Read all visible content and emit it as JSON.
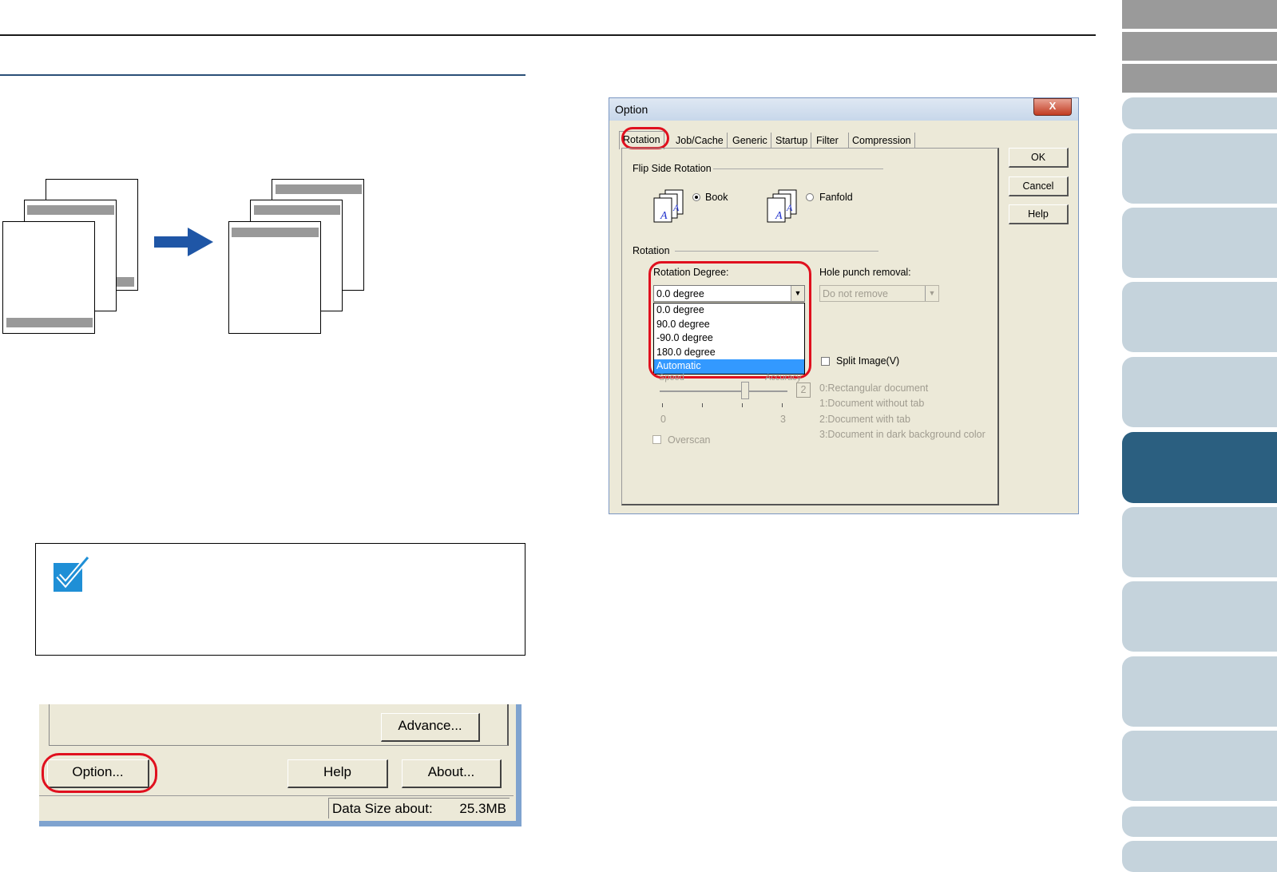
{
  "illustration": {
    "arrow": "right-arrow-icon"
  },
  "note": {
    "icon": "checkmark-icon"
  },
  "main_window": {
    "advance_label": "Advance...",
    "advance_access_key": "v",
    "option_label": "Option...",
    "option_access_key": "p",
    "help_label": "Help",
    "about_label": "About...",
    "data_size_label": "Data Size about:",
    "data_size_value": "25.3MB"
  },
  "dialog": {
    "title": "Option",
    "close_glyph": "X",
    "tabs": [
      "Rotation",
      "Job/Cache",
      "Generic",
      "Startup",
      "Filter",
      "Compression"
    ],
    "active_tab": "Rotation",
    "buttons": {
      "ok": "OK",
      "cancel": "Cancel",
      "help": "Help"
    },
    "flip_side": {
      "group_label": "Flip Side Rotation",
      "book_label": "Book",
      "fanfold_label": "Fanfold",
      "selected": "Book"
    },
    "rotation": {
      "group_label": "Rotation",
      "degree_label": "Rotation Degree:",
      "degree_value": "0.0 degree",
      "degree_options": [
        "0.0 degree",
        "90.0 degree",
        "-90.0 degree",
        "180.0 degree",
        "Automatic"
      ],
      "highlighted_option": "Automatic",
      "hole_punch_label": "Hole punch removal:",
      "hole_punch_value": "Do not remove",
      "split_image_label": "Split Image(V)",
      "speed_label": "Speed",
      "accuracy_label": "Accuracy",
      "slider_value": "2",
      "slider_min": "0",
      "slider_max": "3",
      "document_types": [
        "0:Rectangular document",
        "1:Document without tab",
        "2:Document with tab",
        "3:Document in dark background color"
      ],
      "overscan_label": "Overscan"
    },
    "highlight_color": "#e0101e"
  },
  "side_nav": {
    "active_color": "#2b5f80",
    "inactive_color": "#c5d3dc",
    "header_color": "#9a9a9a",
    "active_index": 5
  }
}
